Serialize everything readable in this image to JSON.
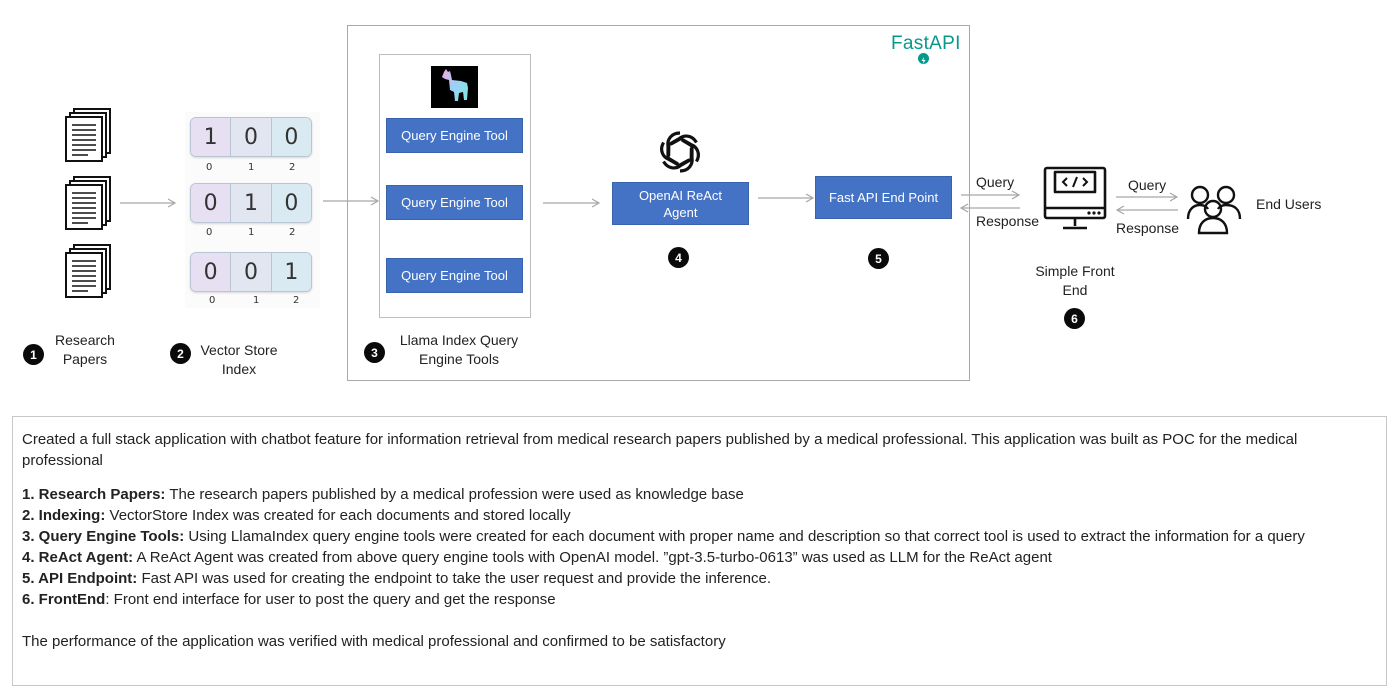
{
  "diagram": {
    "fastapi_logo": "FastAPI",
    "research_papers": "Research Papers",
    "vector_store": {
      "label": "Vector Store Index",
      "rows": [
        {
          "values": [
            "1",
            "0",
            "0"
          ],
          "indices": [
            "0",
            "1",
            "2"
          ]
        },
        {
          "values": [
            "0",
            "1",
            "0"
          ],
          "indices": [
            "0",
            "1",
            "2"
          ]
        },
        {
          "values": [
            "0",
            "0",
            "1"
          ],
          "indices": [
            "0",
            "1",
            "2"
          ]
        }
      ]
    },
    "query_engine_tools": [
      "Query Engine Tool",
      "Query Engine Tool",
      "Query Engine Tool"
    ],
    "llama_label": "Llama Index Query Engine Tools",
    "openai_agent": "OpenAI ReAct Agent",
    "fast_api_endpoint": "Fast API End Point",
    "front_end": "Simple Front End",
    "end_users": "End Users",
    "query": "Query",
    "response": "Response",
    "badges": [
      "1",
      "2",
      "3",
      "4",
      "5",
      "6"
    ]
  },
  "description": {
    "intro": "Created a full stack application with chatbot feature for information retrieval from medical research papers published by a medical professional. This application was built as POC for the medical professional",
    "items": [
      {
        "title": "1. Research Papers:",
        "text": "  The research papers published by a medical profession were used as knowledge base"
      },
      {
        "title": "2. Indexing:",
        "text": " VectorStore Index was created for each documents and stored locally"
      },
      {
        "title": "3. Query Engine Tools:",
        "text": " Using LlamaIndex query engine tools were created for each document with proper name and description so that correct tool is used to extract the information for a query"
      },
      {
        "title": "4. ReAct Agent:",
        "text": " A ReAct Agent was created from above query engine tools with OpenAI model. ”gpt-3.5-turbo-0613” was used as LLM for the ReAct agent"
      },
      {
        "title": "5. API Endpoint:",
        "text": "  Fast API was used for creating the endpoint to take the user request and provide the inference."
      },
      {
        "title": "6. FrontEnd",
        "text": ": Front end interface for user to post the query and get the response"
      }
    ],
    "conclusion": "The performance of the application was verified with medical professional and confirmed to be satisfactory"
  }
}
